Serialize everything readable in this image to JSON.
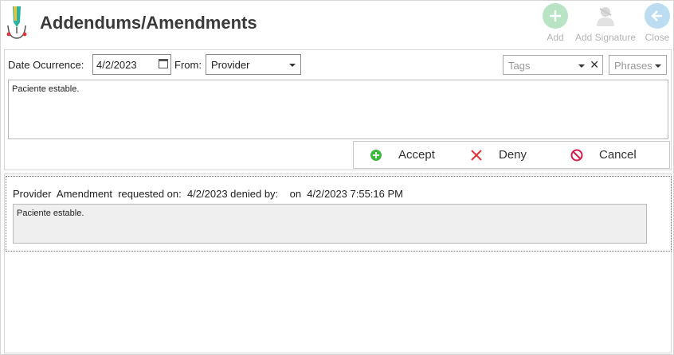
{
  "header": {
    "title": "Addendums/Amendments",
    "buttons": {
      "add": "Add",
      "add_signature": "Add Signature",
      "close": "Close"
    }
  },
  "form": {
    "date_label": "Date Ocurrence:",
    "date_value": "4/2/2023",
    "from_label": "From:",
    "from_value": "Provider",
    "tags_placeholder": "Tags",
    "phrases_placeholder": "Phrases",
    "text": "Paciente estable."
  },
  "actions": {
    "accept": "Accept",
    "deny": "Deny",
    "cancel": "Cancel"
  },
  "entries": [
    {
      "summary": "Provider  Amendment  requested on:  4/2/2023 denied by:    on  4/2/2023 7:55:16 PM",
      "text": "Paciente estable."
    }
  ],
  "colors": {
    "accept": "#3cb93c",
    "deny": "#e0333c",
    "cancel": "#d81b4a",
    "header_add": "#b8e4c5",
    "header_close": "#bcdcf2"
  }
}
